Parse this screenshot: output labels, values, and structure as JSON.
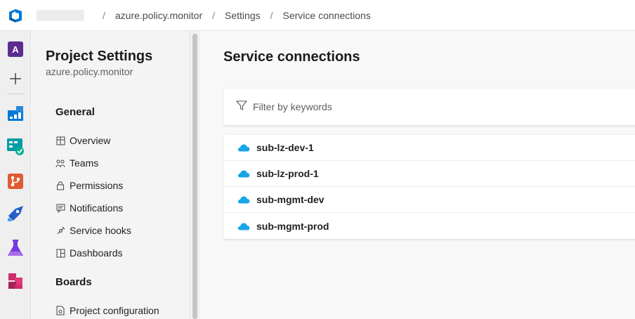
{
  "breadcrumb": {
    "project": "azure.policy.monitor",
    "settings": "Settings",
    "current": "Service connections",
    "separator": "/"
  },
  "rail": {
    "project_initial": "A",
    "project_color": "#5c2d91",
    "add_icon": "plus-icon"
  },
  "nav": {
    "title": "Project Settings",
    "subtitle": "azure.policy.monitor",
    "sections": {
      "general": "General",
      "boards": "Boards"
    },
    "items": [
      {
        "label": "Overview",
        "icon": "overview-icon"
      },
      {
        "label": "Teams",
        "icon": "teams-icon"
      },
      {
        "label": "Permissions",
        "icon": "lock-icon"
      },
      {
        "label": "Notifications",
        "icon": "notifications-icon"
      },
      {
        "label": "Service hooks",
        "icon": "service-hooks-icon"
      },
      {
        "label": "Dashboards",
        "icon": "dashboards-icon"
      },
      {
        "label": "Project configuration",
        "icon": "project-config-icon"
      }
    ]
  },
  "main": {
    "title": "Service connections",
    "filter_placeholder": "Filter by keywords",
    "connections": [
      {
        "name": "sub-lz-dev-1"
      },
      {
        "name": "sub-lz-prod-1"
      },
      {
        "name": "sub-mgmt-dev"
      },
      {
        "name": "sub-mgmt-prod"
      }
    ],
    "cloud_color": "#16a6e8"
  }
}
